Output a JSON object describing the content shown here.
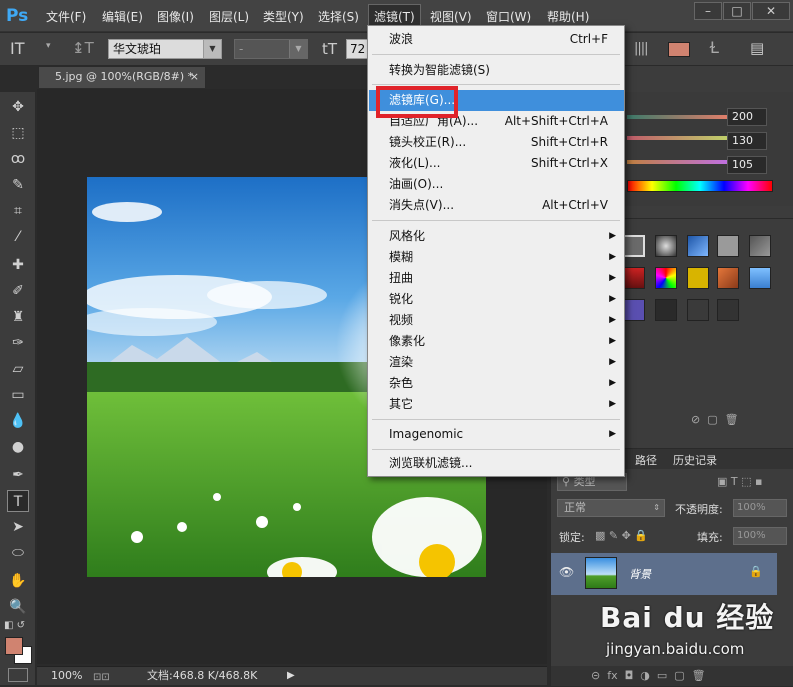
{
  "app": {
    "logo": "Ps"
  },
  "menubar": {
    "items": [
      "文件(F)",
      "编辑(E)",
      "图像(I)",
      "图层(L)",
      "类型(Y)",
      "选择(S)",
      "滤镜(T)",
      "视图(V)",
      "窗口(W)",
      "帮助(H)"
    ],
    "active": "滤镜(T)"
  },
  "options": {
    "font_family": "华文琥珀",
    "font_style": "-",
    "font_size": "72"
  },
  "document": {
    "tab_title": "5.jpg @ 100%(RGB/8#) *",
    "close": "×"
  },
  "status": {
    "zoom": "100%",
    "doc_info": "文档:468.8 K/468.8K"
  },
  "color_panel": {
    "values": [
      "200",
      "130",
      "105"
    ]
  },
  "layers_panel": {
    "tabs": [
      "路径",
      "历史记录"
    ],
    "kind": "类型",
    "blend_mode": "正常",
    "opacity_label": "不透明度:",
    "opacity_value": "100%",
    "lock_label": "锁定:",
    "fill_label": "填充:",
    "fill_value": "100%",
    "layer_name": "背景"
  },
  "filter_menu": {
    "group1": [
      {
        "label": "波浪",
        "shortcut": "Ctrl+F"
      }
    ],
    "group2": [
      {
        "label": "转换为智能滤镜(S)"
      }
    ],
    "group3": [
      {
        "label": "滤镜库(G)...",
        "highlighted": true
      },
      {
        "label": "自适应广角(A)...",
        "shortcut": "Alt+Shift+Ctrl+A"
      },
      {
        "label": "镜头校正(R)...",
        "shortcut": "Shift+Ctrl+R"
      },
      {
        "label": "液化(L)...",
        "shortcut": "Shift+Ctrl+X"
      },
      {
        "label": "油画(O)..."
      },
      {
        "label": "消失点(V)...",
        "shortcut": "Alt+Ctrl+V"
      }
    ],
    "group4": [
      "风格化",
      "模糊",
      "扭曲",
      "锐化",
      "视频",
      "像素化",
      "渲染",
      "杂色",
      "其它"
    ],
    "group5": [
      "Imagenomic"
    ],
    "group6": [
      {
        "label": "浏览联机滤镜..."
      }
    ]
  },
  "watermark": {
    "brand": "Bai du 经验",
    "url": "jingyan.baidu.com"
  },
  "colors": {
    "highlight": "#3f8fdc",
    "redbox": "#e0232a",
    "foreground": "#d08370"
  }
}
